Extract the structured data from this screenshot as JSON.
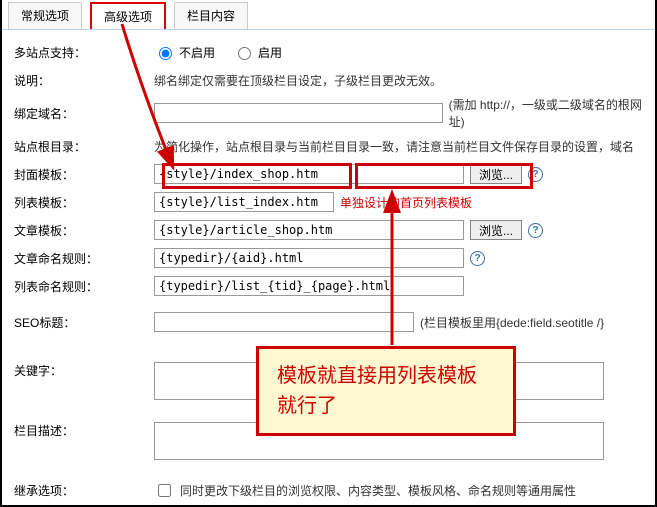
{
  "tabs": {
    "general": "常规选项",
    "advanced": "高级选项",
    "column": "栏目内容"
  },
  "rows": {
    "multisite_label": "多站点支持：",
    "multisite_off": "不启用",
    "multisite_on": "启用",
    "desc_label": "说明：",
    "desc_text": "绑名绑定仅需要在顶级栏目设定，子级栏目更改无效。",
    "bind_domain_label": "绑定域名：",
    "bind_domain_value": "",
    "bind_domain_note": "(需加 http://，一级或二级域名的根网址)",
    "site_root_label": "站点根目录：",
    "site_root_text": "为简化操作，站点根目录与当前栏目目录一致，请注意当前栏目文件保存目录的设置，域名",
    "cover_tpl_label": "封面模板：",
    "cover_tpl_value": "{style}/index_shop.htm",
    "list_tpl_label": "列表模板：",
    "list_tpl_value": "{style}/list_index.htm",
    "article_tpl_label": "文章模板：",
    "article_tpl_value": "{style}/article_shop.htm",
    "article_rule_label": "文章命名规则：",
    "article_rule_value": "{typedir}/{aid}.html",
    "list_rule_label": "列表命名规则：",
    "list_rule_value": "{typedir}/list_{tid}_{page}.html",
    "seo_title_label": "SEO标题：",
    "seo_title_value": "",
    "seo_title_note": "(栏目模板里用{dede:field.seotitle /}",
    "keywords_label": "关键字：",
    "column_desc_label": "栏目描述：",
    "inherit_label": "继承选项：",
    "inherit_text": "同时更改下级栏目的浏览权限、内容类型、模板风格、命名规则等通用属性"
  },
  "buttons": {
    "browse": "浏览..."
  },
  "annotations": {
    "list_hint": "单独设计的首页列表模板",
    "callout": "模板就直接用列表模板就行了"
  }
}
